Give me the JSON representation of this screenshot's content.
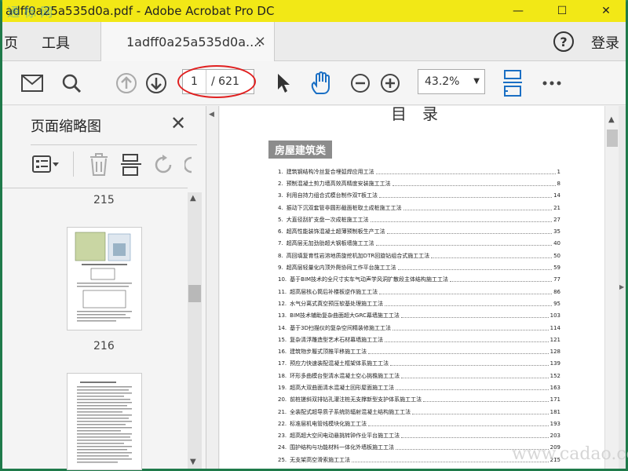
{
  "titlebar": {
    "title": "adff0a25a535d0a.pdf - Adobe Acrobat Pro DC",
    "watermark": "通 标 网",
    "min": "—",
    "max": "☐",
    "close": "✕"
  },
  "menubar": {
    "items": [
      "页",
      "工具"
    ],
    "help": "?",
    "login": "登录"
  },
  "tab": {
    "label": "1adff0a25a535d0a....",
    "close": "×"
  },
  "toolbar": {
    "page_current": "1",
    "page_total": "/ 621",
    "zoom": "43.2%"
  },
  "thumbnails": {
    "title": "页面缩略图",
    "page_numbers": [
      "215",
      "216"
    ]
  },
  "document": {
    "heading": "目录",
    "section": "房屋建筑类",
    "toc": [
      {
        "n": "1.",
        "t": "建筑钢结构冷丝复合埋弧焊应用工法",
        "p": "1"
      },
      {
        "n": "2.",
        "t": "预制混凝土剪力墙高效高精度安装施工工法",
        "p": "8"
      },
      {
        "n": "3.",
        "t": "利用自持力组合式模台制作双T板工法",
        "p": "14"
      },
      {
        "n": "4.",
        "t": "振动下沉双套管非圆形截面桩取土成桩施工工法",
        "p": "21"
      },
      {
        "n": "5.",
        "t": "大直径刮扩支盘一次成桩施工工法",
        "p": "27"
      },
      {
        "n": "6.",
        "t": "超高性能装饰混凝土超薄预制板生产工法",
        "p": "35"
      },
      {
        "n": "7.",
        "t": "超高层无加劲肋超大钢板墙施工工法",
        "p": "40"
      },
      {
        "n": "8.",
        "t": "高回填复育性岩溶地质旋挖机加DTR回旋钻组合式施工工法",
        "p": "50"
      },
      {
        "n": "9.",
        "t": "超高层轻量化内顶外爬协同工作平台施工工法",
        "p": "59"
      },
      {
        "n": "10.",
        "t": "基于BIM技术的全尺寸实车气动声学风洞扩散段主体结构施工工法",
        "p": "77"
      },
      {
        "n": "11.",
        "t": "超高层核心筒后补楼板逆作施工工法",
        "p": "86"
      },
      {
        "n": "12.",
        "t": "水气分离式真空预压软基处理施工工法",
        "p": "95"
      },
      {
        "n": "13.",
        "t": "BIM技术辅助复杂曲面超大GRC幕墙施工工法",
        "p": "103"
      },
      {
        "n": "14.",
        "t": "基于3D扫描仪的复杂空间精装修施工工法",
        "p": "114"
      },
      {
        "n": "15.",
        "t": "复杂清浮雕造型艺术石材幕墙施工工法",
        "p": "121"
      },
      {
        "n": "16.",
        "t": "建筑物步履式顶推平移施工工法",
        "p": "128"
      },
      {
        "n": "17.",
        "t": "预应力快速装配混凝土框架体系施工工法",
        "p": "139"
      },
      {
        "n": "18.",
        "t": "环形多曲模台型清水混凝土空心挑檐施工工法",
        "p": "152"
      },
      {
        "n": "19.",
        "t": "超高大双曲面清水混凝土回形屋面施工工法",
        "p": "163"
      },
      {
        "n": "20.",
        "t": "前桩搓斜双排钻孔灌注桩无支撑新型支护体系施工工法",
        "p": "171"
      },
      {
        "n": "21.",
        "t": "全装配式超导质子系统防辐射混凝土结构施工工法",
        "p": "181"
      },
      {
        "n": "22.",
        "t": "标准层机电管线模块化施工工法",
        "p": "193"
      },
      {
        "n": "23.",
        "t": "超高超大空间电动悬挑转钟作业平台施工工法",
        "p": "203"
      },
      {
        "n": "24.",
        "t": "围护结构与功能材料一体化外墙板施工工法",
        "p": "209"
      },
      {
        "n": "25.",
        "t": "无支架高空滑索施工工法",
        "p": "215"
      }
    ],
    "bottom_watermark": "www.cadao.com"
  }
}
